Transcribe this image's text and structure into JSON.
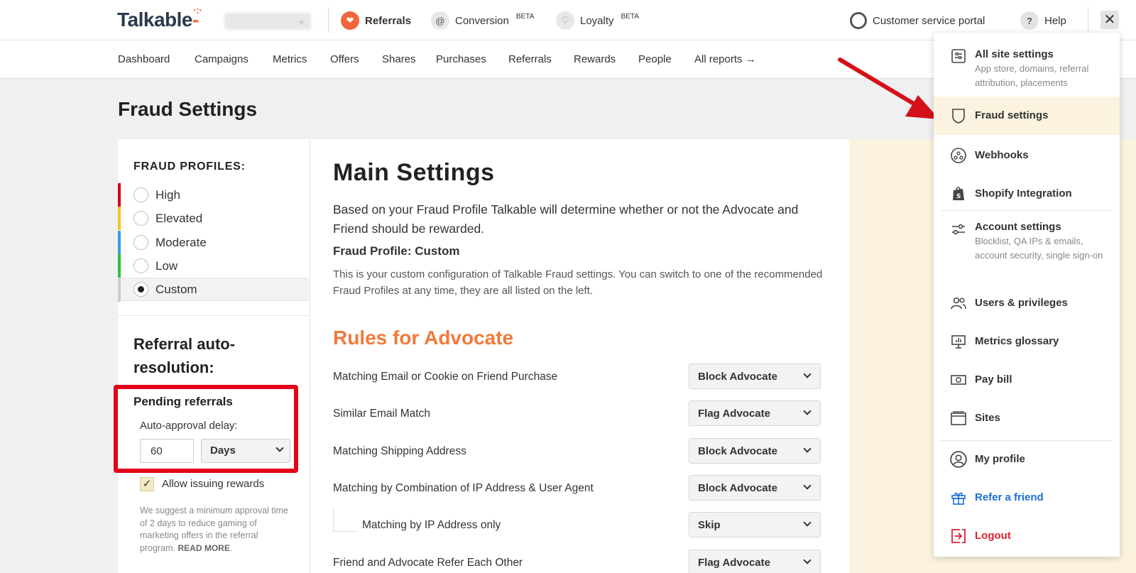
{
  "topbar": {
    "logo": "Talkable",
    "nav": [
      {
        "label": "Referrals",
        "badge": ""
      },
      {
        "label": "Conversion",
        "badge": "BETA"
      },
      {
        "label": "Loyalty",
        "badge": "BETA"
      }
    ],
    "customer_service": "Customer service portal",
    "help": "Help",
    "close_glyph": "✕"
  },
  "subnav": {
    "items": [
      "Dashboard",
      "Campaigns",
      "Metrics",
      "Offers",
      "Shares",
      "Purchases",
      "Referrals",
      "Rewards",
      "People",
      "All reports →"
    ]
  },
  "page_title": "Fraud Settings",
  "fraud_profiles": {
    "heading": "FRAUD PROFILES:",
    "items": [
      {
        "label": "High",
        "color": "#d0021b",
        "selected": false
      },
      {
        "label": "Elevated",
        "color": "#f5c518",
        "selected": false
      },
      {
        "label": "Moderate",
        "color": "#3b9ae1",
        "selected": false
      },
      {
        "label": "Low",
        "color": "#2fbf3a",
        "selected": false
      },
      {
        "label": "Custom",
        "color": "#cccccc",
        "selected": true
      }
    ]
  },
  "auto_resolution": {
    "heading": "Referral auto-resolution:",
    "pending_title": "Pending referrals",
    "delay_label": "Auto-approval delay:",
    "delay_value": "60",
    "unit": "Days",
    "allow_label": "Allow issuing rewards",
    "allow_checked": true,
    "suggestion": "We suggest a minimum approval time of 2 days to reduce gaming of marketing offers in the referral program.",
    "read_more": "READ MORE"
  },
  "main": {
    "heading": "Main Settings",
    "description": "Based on your Fraud Profile Talkable will determine whether or not the Advocate and Friend should be rewarded.",
    "profile_title": "Fraud Profile: Custom",
    "profile_desc": "This is your custom configuration of Talkable Fraud settings. You can switch to one of the recommended Fraud Profiles at any time, they are all listed on the left.",
    "rules_heading": "Rules for Advocate",
    "rules": [
      {
        "label": "Matching Email or Cookie on Friend Purchase",
        "value": "Block Advocate"
      },
      {
        "label": "Similar Email Match",
        "value": "Flag Advocate"
      },
      {
        "label": "Matching Shipping Address",
        "value": "Block Advocate"
      },
      {
        "label": "Matching by Combination of IP Address & User Agent",
        "value": "Block Advocate"
      },
      {
        "label": "Matching by IP Address only",
        "value": "Skip"
      },
      {
        "label": "Friend and Advocate Refer Each Other",
        "value": "Flag Advocate"
      }
    ]
  },
  "dropdown": {
    "items": [
      {
        "title": "All site settings",
        "desc": "App store, domains, referral attribution, placements",
        "icon": "sliders-doc-icon"
      },
      {
        "title": "Fraud settings",
        "desc": "",
        "icon": "shield-icon"
      },
      {
        "title": "Webhooks",
        "desc": "",
        "icon": "webhook-icon"
      },
      {
        "title": "Shopify Integration",
        "desc": "",
        "icon": "shopify-bag-icon"
      },
      {
        "title": "Account settings",
        "desc": "Blocklist, QA IPs & emails, account security, single sign-on",
        "icon": "sliders-icon"
      },
      {
        "title": "Users & privileges",
        "desc": "",
        "icon": "users-icon"
      },
      {
        "title": "Metrics glossary",
        "desc": "",
        "icon": "presentation-icon"
      },
      {
        "title": "Pay bill",
        "desc": "",
        "icon": "banknote-icon"
      },
      {
        "title": "Sites",
        "desc": "",
        "icon": "window-icon"
      },
      {
        "title": "My profile",
        "desc": "",
        "icon": "user-circle-icon"
      },
      {
        "title": "Refer a friend",
        "desc": "",
        "icon": "gift-icon"
      },
      {
        "title": "Logout",
        "desc": "",
        "icon": "logout-icon"
      }
    ]
  },
  "colors": {
    "accent_orange": "#f07a3c",
    "highlight_yellow": "#fbf3df",
    "annotation_red": "#e2001a",
    "link_blue": "#1a6fd8",
    "logout_red": "#e02030"
  }
}
